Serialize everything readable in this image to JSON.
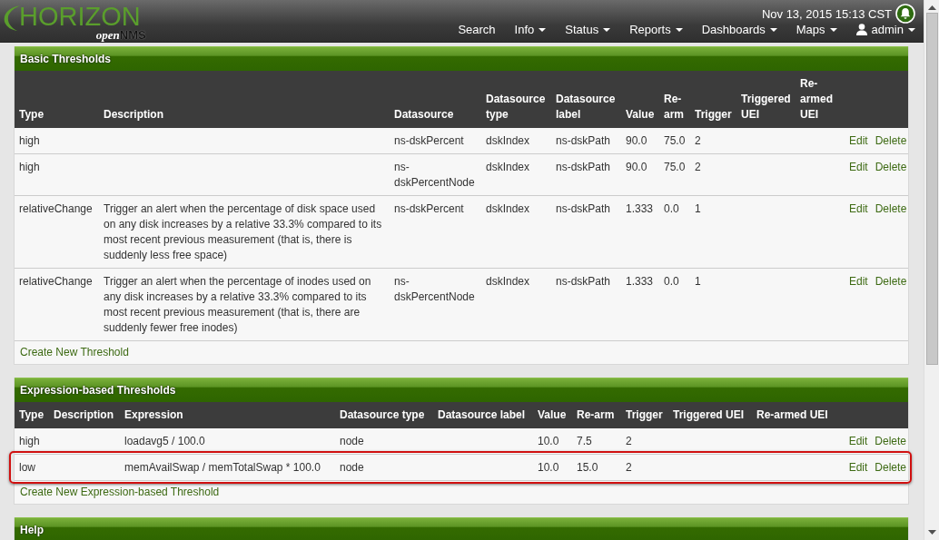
{
  "header": {
    "logo": {
      "title": "HORIZON",
      "prefix": "open",
      "suffix": "NMS"
    },
    "datetime": "Nov 13, 2015 15:13 CST",
    "nav": [
      {
        "label": "Search",
        "dropdown": false,
        "kind": "text"
      },
      {
        "label": "Info",
        "dropdown": true,
        "kind": "text"
      },
      {
        "label": "Status",
        "dropdown": true,
        "kind": "text"
      },
      {
        "label": "Reports",
        "dropdown": true,
        "kind": "text"
      },
      {
        "label": "Dashboards",
        "dropdown": true,
        "kind": "text"
      },
      {
        "label": "Maps",
        "dropdown": true,
        "kind": "text"
      },
      {
        "label": "admin",
        "dropdown": true,
        "kind": "user"
      }
    ]
  },
  "panels": [
    {
      "title": "Basic Thresholds",
      "table": {
        "columns": [
          "Type",
          "Description",
          "Datasource",
          "Datasource type",
          "Datasource label",
          "Value",
          "Re-arm",
          "Trigger",
          "Triggered UEI",
          "Re-armed UEI"
        ],
        "rows": [
          {
            "cells": [
              "high",
              "",
              "ns-dskPercent",
              "dskIndex",
              "ns-dskPath",
              "90.0",
              "75.0",
              "2",
              "",
              ""
            ],
            "actions": [
              "Edit",
              "Delete"
            ],
            "highlighted": false
          },
          {
            "cells": [
              "high",
              "",
              "ns-dskPercentNode",
              "dskIndex",
              "ns-dskPath",
              "90.0",
              "75.0",
              "2",
              "",
              ""
            ],
            "actions": [
              "Edit",
              "Delete"
            ],
            "highlighted": false
          },
          {
            "cells": [
              "relativeChange",
              "Trigger an alert when the percentage of disk space used on any disk increases by a relative 33.3% compared to its most recent previous measurement (that is, there is suddenly less free space)",
              "ns-dskPercent",
              "dskIndex",
              "ns-dskPath",
              "1.333",
              "0.0",
              "1",
              "",
              ""
            ],
            "actions": [
              "Edit",
              "Delete"
            ],
            "highlighted": false
          },
          {
            "cells": [
              "relativeChange",
              "Trigger an alert when the percentage of inodes used on any disk increases by a relative 33.3% compared to its most recent previous measurement (that is, there are suddenly fewer free inodes)",
              "ns-dskPercentNode",
              "dskIndex",
              "ns-dskPath",
              "1.333",
              "0.0",
              "1",
              "",
              ""
            ],
            "actions": [
              "Edit",
              "Delete"
            ],
            "highlighted": false
          }
        ],
        "footer_link": "Create New Threshold"
      }
    },
    {
      "title": "Expression-based Thresholds",
      "table": {
        "columns": [
          "Type",
          "Description",
          "Expression",
          "Datasource type",
          "Datasource label",
          "Value",
          "Re-arm",
          "Trigger",
          "Triggered UEI",
          "Re-armed UEI"
        ],
        "rows": [
          {
            "cells": [
              "high",
              "",
              "loadavg5 / 100.0",
              "node",
              "",
              "10.0",
              "7.5",
              "2",
              "",
              ""
            ],
            "actions": [
              "Edit",
              "Delete"
            ],
            "highlighted": false
          },
          {
            "cells": [
              "low",
              "",
              "memAvailSwap / memTotalSwap * 100.0",
              "node",
              "",
              "10.0",
              "15.0",
              "2",
              "",
              ""
            ],
            "actions": [
              "Edit",
              "Delete"
            ],
            "highlighted": true
          }
        ],
        "footer_link": "Create New Expression-based Threshold"
      }
    },
    {
      "title": "Help"
    }
  ]
}
